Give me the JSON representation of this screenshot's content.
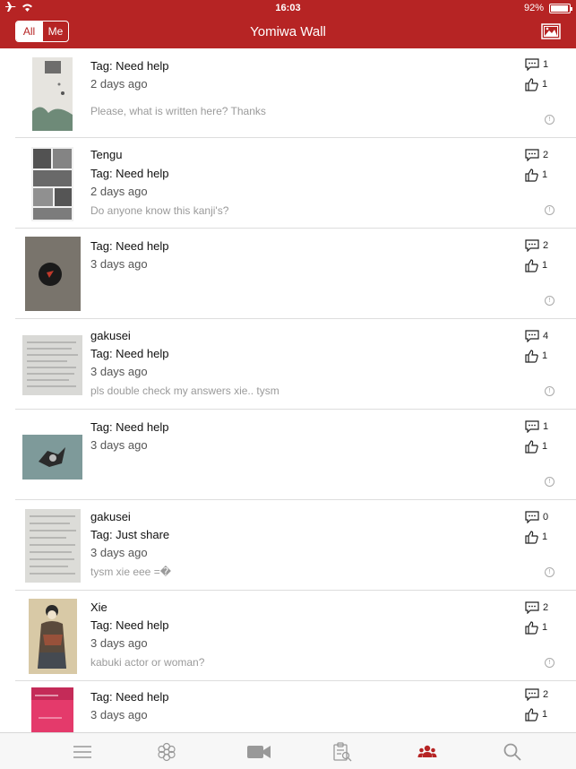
{
  "status_bar": {
    "time": "16:03",
    "battery": "92%"
  },
  "header": {
    "title": "Yomiwa Wall",
    "filter_all": "All",
    "filter_me": "Me",
    "accent": "#b62424"
  },
  "posts": [
    {
      "user": "",
      "tag": "Tag: Need help",
      "ago": "2 days ago",
      "message": "Please, what is written here? Thanks",
      "comments": "1",
      "likes": "1"
    },
    {
      "user": "Tengu",
      "tag": "Tag: Need help",
      "ago": "2 days ago",
      "message": "Do anyone know this kanji's?",
      "comments": "2",
      "likes": "1"
    },
    {
      "user": "",
      "tag": "Tag: Need help",
      "ago": "3 days ago",
      "message": "",
      "comments": "2",
      "likes": "1"
    },
    {
      "user": "gakusei",
      "tag": "Tag: Need help",
      "ago": "3 days ago",
      "message": "pls double check my answers xie.. tysm",
      "comments": "4",
      "likes": "1"
    },
    {
      "user": "",
      "tag": "Tag: Need help",
      "ago": "3 days ago",
      "message": "",
      "comments": "1",
      "likes": "1"
    },
    {
      "user": "gakusei",
      "tag": "Tag: Just share",
      "ago": "3 days ago",
      "message": "tysm xie eee =�",
      "comments": "0",
      "likes": "1"
    },
    {
      "user": "Xie",
      "tag": "Tag: Need help",
      "ago": "3 days ago",
      "message": "kabuki actor or woman?",
      "comments": "2",
      "likes": "1"
    },
    {
      "user": "",
      "tag": "Tag: Need help",
      "ago": "3 days ago",
      "message": "",
      "comments": "2",
      "likes": "1"
    }
  ],
  "tabs": [
    {
      "icon": "menu-icon"
    },
    {
      "icon": "flower-icon"
    },
    {
      "icon": "video-camera-icon"
    },
    {
      "icon": "clipboard-search-icon"
    },
    {
      "icon": "community-icon",
      "active": true
    },
    {
      "icon": "search-icon"
    }
  ]
}
